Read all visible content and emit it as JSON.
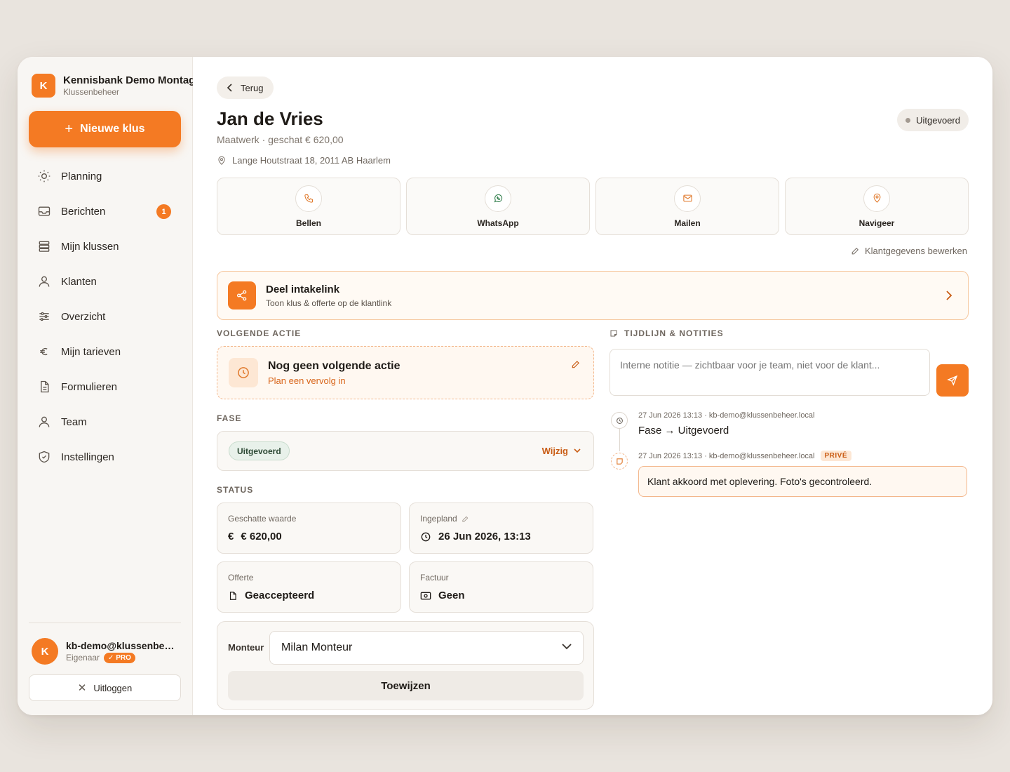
{
  "sidebar": {
    "brand": {
      "logo_letter": "K",
      "name": "Kennisbank Demo Montage",
      "subtitle": "Klussenbeheer"
    },
    "new_button_label": "Nieuwe klus",
    "items": [
      {
        "label": "Planning",
        "icon": "sun-icon"
      },
      {
        "label": "Berichten",
        "icon": "inbox-icon",
        "badge": "1"
      },
      {
        "label": "Mijn klussen",
        "icon": "stack-icon"
      },
      {
        "label": "Klanten",
        "icon": "user-icon"
      },
      {
        "label": "Overzicht",
        "icon": "sliders-icon"
      },
      {
        "label": "Mijn tarieven",
        "icon": "euro-icon"
      },
      {
        "label": "Formulieren",
        "icon": "document-icon"
      },
      {
        "label": "Team",
        "icon": "user-icon"
      },
      {
        "label": "Instellingen",
        "icon": "shield-icon"
      }
    ],
    "user": {
      "avatar_letter": "K",
      "email": "kb-demo@klussenbeheer.local",
      "role": "Eigenaar",
      "plan_badge": "PRO"
    },
    "logout_label": "Uitloggen"
  },
  "header": {
    "back_label": "Terug",
    "title": "Jan de Vries",
    "subtitle": "Maatwerk · geschat € 620,00",
    "address": "Lange Houtstraat 18, 2011 AB Haarlem",
    "status": "Uitgevoerd"
  },
  "contact_actions": [
    {
      "label": "Bellen",
      "icon": "phone-icon",
      "color": "#e0782a"
    },
    {
      "label": "WhatsApp",
      "icon": "whatsapp-icon",
      "color": "#2f7d4a"
    },
    {
      "label": "Mailen",
      "icon": "mail-icon",
      "color": "#e0782a"
    },
    {
      "label": "Navigeer",
      "icon": "map-pin-icon",
      "color": "#e0782a"
    }
  ],
  "edit_client_label": "Klantgegevens bewerken",
  "share": {
    "title": "Deel intakelink",
    "subtitle": "Toon klus & offerte op de klantlink"
  },
  "next_action": {
    "section_label": "VOLGENDE ACTIE",
    "title": "Nog geen volgende actie",
    "subtitle": "Plan een vervolg in"
  },
  "phase": {
    "section_label": "FASE",
    "value": "Uitgevoerd",
    "change_label": "Wijzig"
  },
  "status": {
    "section_label": "STATUS",
    "cards": [
      {
        "label": "Geschatte waarde",
        "value": "€ 620,00",
        "icon": "euro-icon"
      },
      {
        "label": "Ingepland",
        "value": "26 Jun 2026, 13:13",
        "icon": "clock-icon"
      },
      {
        "label": "Offerte",
        "value": "Geaccepteerd",
        "icon": "document-icon"
      },
      {
        "label": "Factuur",
        "value": "Geen",
        "icon": "cash-icon"
      }
    ]
  },
  "assign": {
    "label": "Monteur",
    "selected": "Milan Monteur",
    "button_label": "Toewijzen"
  },
  "timeline": {
    "section_label": "TIJDLIJN & NOTITIES",
    "note_placeholder": "Interne notitie — zichtbaar voor je team, niet voor de klant...",
    "entries": [
      {
        "meta": "27 Jun 2026 13:13 · kb-demo@klussenbeheer.local",
        "text": "Fase → Uitgevoerd"
      },
      {
        "meta": "27 Jun 2026 13:13 · kb-demo@klussenbeheer.local",
        "badge": "PRIVÉ",
        "text": "Klant akkoord met oplevering. Foto's gecontroleerd."
      }
    ]
  },
  "colors": {
    "accent": "#f47a23",
    "accent_text": "#c95c14",
    "background": "#e9e4de"
  }
}
